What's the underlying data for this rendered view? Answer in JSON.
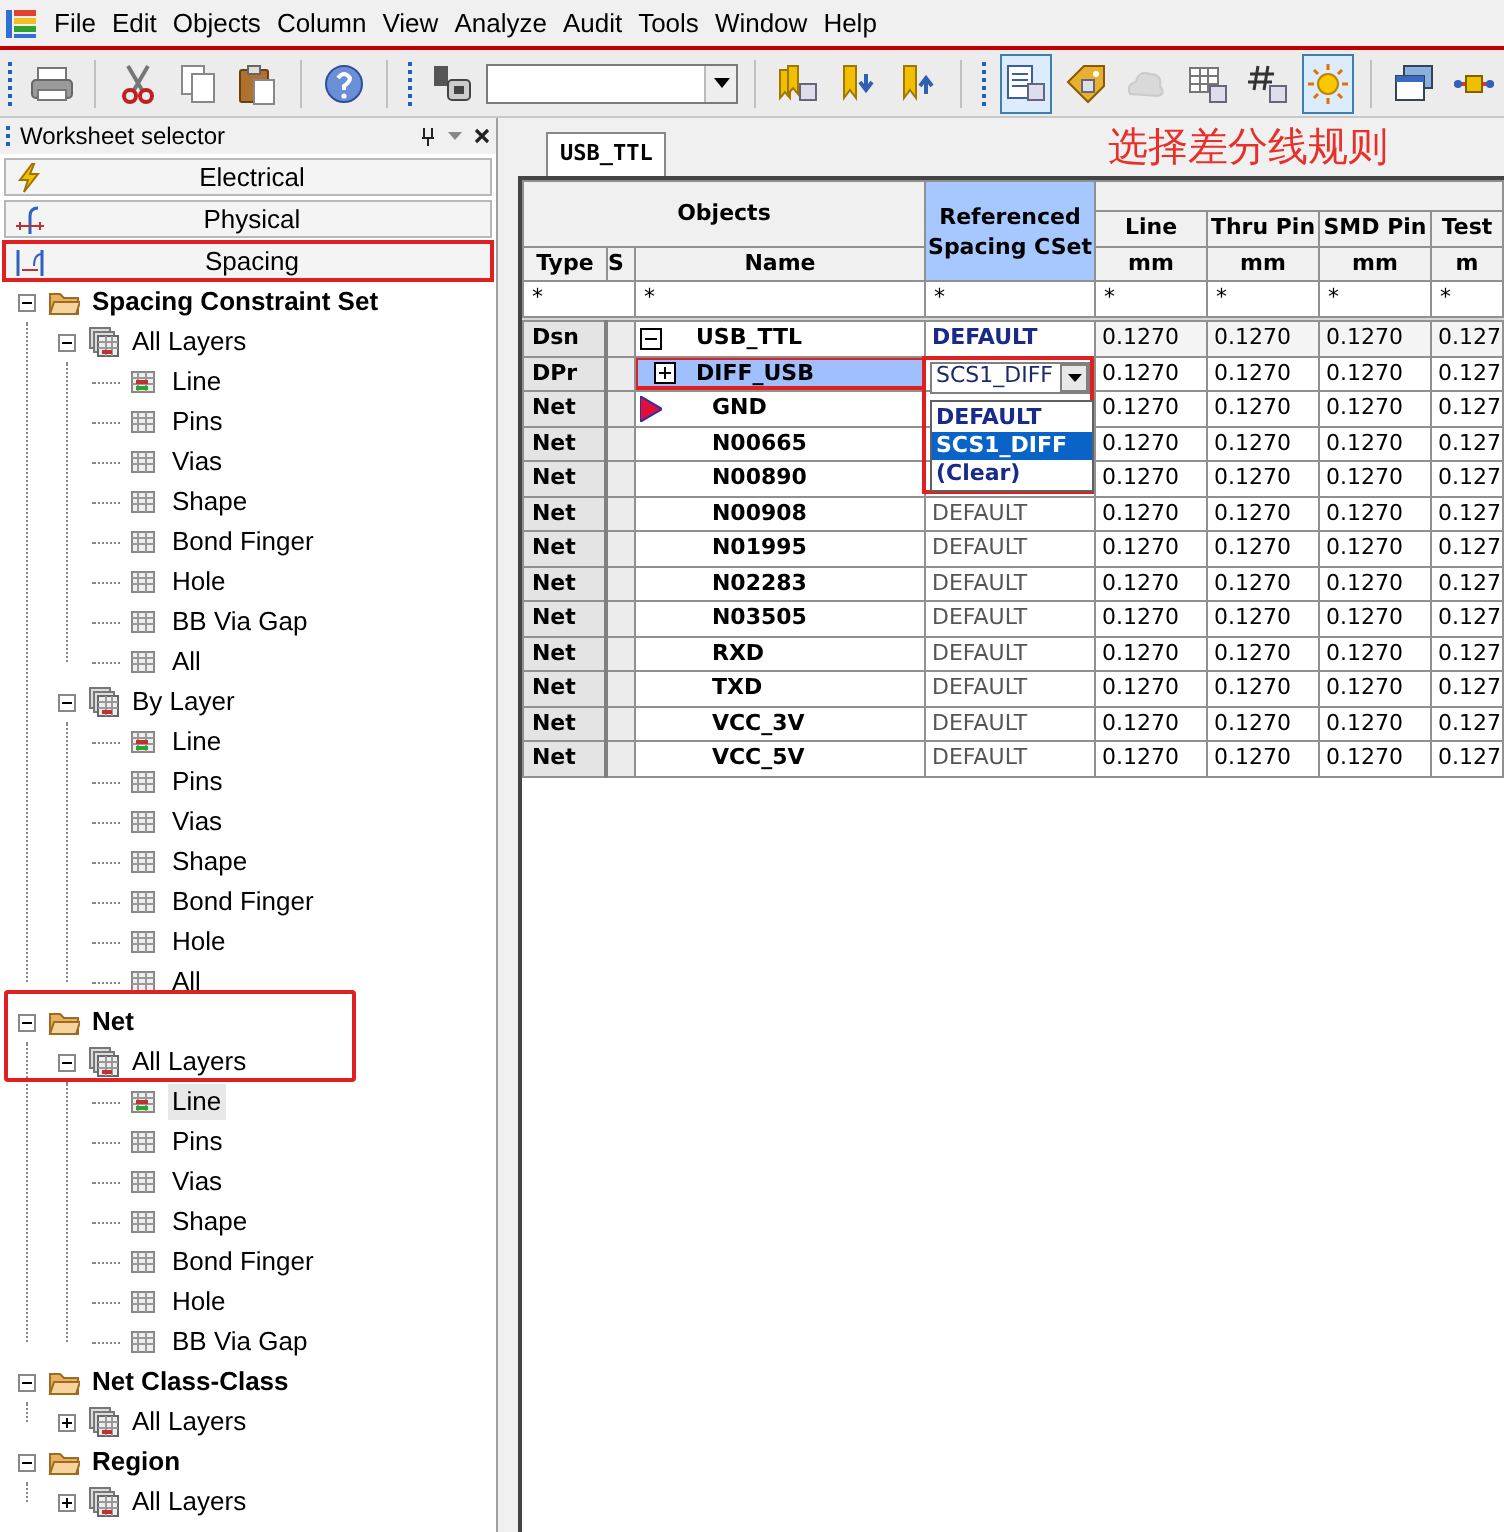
{
  "menu": [
    "File",
    "Edit",
    "Objects",
    "Column",
    "View",
    "Analyze",
    "Audit",
    "Tools",
    "Window",
    "Help"
  ],
  "toolbar": [
    {
      "kind": "grip"
    },
    {
      "kind": "printer",
      "selected": false
    },
    {
      "kind": "sep"
    },
    {
      "kind": "scissors",
      "selected": false
    },
    {
      "kind": "copy",
      "selected": false
    },
    {
      "kind": "paste",
      "selected": false
    },
    {
      "kind": "sep"
    },
    {
      "kind": "help",
      "selected": false
    },
    {
      "kind": "sep"
    },
    {
      "kind": "grip"
    },
    {
      "kind": "component",
      "selected": false
    },
    {
      "kind": "combo"
    },
    {
      "kind": "sep"
    },
    {
      "kind": "bookmarks",
      "selected": false
    },
    {
      "kind": "bookmark-down",
      "selected": false
    },
    {
      "kind": "bookmark-up",
      "selected": false
    },
    {
      "kind": "sep"
    },
    {
      "kind": "grip"
    },
    {
      "kind": "worksheet",
      "selected": true
    },
    {
      "kind": "tag",
      "selected": false
    },
    {
      "kind": "cloud",
      "selected": false,
      "disabled": true
    },
    {
      "kind": "grid",
      "selected": false
    },
    {
      "kind": "hash",
      "selected": false
    },
    {
      "kind": "sun",
      "selected": true
    },
    {
      "kind": "sep"
    },
    {
      "kind": "windows",
      "selected": false
    },
    {
      "kind": "connector",
      "selected": false
    }
  ],
  "sidebar": {
    "title": "Worksheet selector",
    "tabs": [
      {
        "label": "Electrical",
        "kind": "electrical",
        "highlighted": false
      },
      {
        "label": "Physical",
        "kind": "physical",
        "highlighted": false
      },
      {
        "label": "Spacing",
        "kind": "spacing",
        "highlighted": true
      }
    ],
    "tree": [
      {
        "label": "Spacing Constraint Set",
        "kind": "folder",
        "expanded": true,
        "selected": false,
        "highlighted": false,
        "children": [
          {
            "label": "All Layers",
            "kind": "layers",
            "expanded": true,
            "selected": false,
            "children": [
              {
                "label": "Line",
                "kind": "sheet-marked",
                "selected": false
              },
              {
                "label": "Pins",
                "kind": "sheet",
                "selected": false
              },
              {
                "label": "Vias",
                "kind": "sheet",
                "selected": false
              },
              {
                "label": "Shape",
                "kind": "sheet",
                "selected": false
              },
              {
                "label": "Bond Finger",
                "kind": "sheet",
                "selected": false
              },
              {
                "label": "Hole",
                "kind": "sheet",
                "selected": false
              },
              {
                "label": "BB Via Gap",
                "kind": "sheet",
                "selected": false
              },
              {
                "label": "All",
                "kind": "sheet",
                "selected": false
              }
            ]
          },
          {
            "label": "By Layer",
            "kind": "layers",
            "expanded": true,
            "selected": false,
            "children": [
              {
                "label": "Line",
                "kind": "sheet-marked",
                "selected": false
              },
              {
                "label": "Pins",
                "kind": "sheet",
                "selected": false
              },
              {
                "label": "Vias",
                "kind": "sheet",
                "selected": false
              },
              {
                "label": "Shape",
                "kind": "sheet",
                "selected": false
              },
              {
                "label": "Bond Finger",
                "kind": "sheet",
                "selected": false
              },
              {
                "label": "Hole",
                "kind": "sheet",
                "selected": false
              },
              {
                "label": "All",
                "kind": "sheet",
                "selected": false
              }
            ]
          }
        ]
      },
      {
        "label": "Net",
        "kind": "folder",
        "expanded": true,
        "selected": false,
        "highlighted": true,
        "children": [
          {
            "label": "All Layers",
            "kind": "layers",
            "expanded": true,
            "selected": false,
            "children": [
              {
                "label": "Line",
                "kind": "sheet-marked",
                "selected": true
              },
              {
                "label": "Pins",
                "kind": "sheet",
                "selected": false
              },
              {
                "label": "Vias",
                "kind": "sheet",
                "selected": false
              },
              {
                "label": "Shape",
                "kind": "sheet",
                "selected": false
              },
              {
                "label": "Bond Finger",
                "kind": "sheet",
                "selected": false
              },
              {
                "label": "Hole",
                "kind": "sheet",
                "selected": false
              },
              {
                "label": "BB Via Gap",
                "kind": "sheet",
                "selected": false
              }
            ]
          }
        ]
      },
      {
        "label": "Net Class-Class",
        "kind": "folder",
        "expanded": true,
        "selected": false,
        "highlighted": false,
        "children": [
          {
            "label": "All Layers",
            "kind": "layers",
            "expanded": false,
            "selected": false
          }
        ]
      },
      {
        "label": "Region",
        "kind": "folder",
        "expanded": true,
        "selected": false,
        "highlighted": false,
        "children": [
          {
            "label": "All Layers",
            "kind": "layers",
            "expanded": false,
            "selected": false
          }
        ]
      }
    ]
  },
  "workspace": {
    "tab": "USB_TTL",
    "annotation": "选择差分线规则",
    "grid": {
      "group_header": "Objects",
      "cset_header": "Referenced Spacing CSet",
      "type_header": "Type",
      "s_header": "S",
      "name_header": "Name",
      "columns": [
        {
          "label": "Line",
          "unit": "mm"
        },
        {
          "label": "Thru Pin",
          "unit": "mm"
        },
        {
          "label": "SMD Pin",
          "unit": "mm"
        },
        {
          "label": "Test",
          "unit": "m"
        }
      ],
      "filters": [
        "*",
        "*",
        "*",
        "*",
        "*",
        "*",
        "*"
      ],
      "rows": [
        {
          "kind": "design",
          "type": "Dsn",
          "name": "USB_TTL",
          "expanded": true,
          "selected": false,
          "cset": "DEFAULT",
          "values": [
            "0.1270",
            "0.1270",
            "0.1270",
            "0.127"
          ]
        },
        {
          "kind": "pair",
          "type": "DPr",
          "name": "DIFF_USB",
          "expanded": false,
          "selected": true,
          "highlighted": true,
          "values": [
            "0.1270",
            "0.1270",
            "0.1270",
            "0.127"
          ],
          "dropdown": {
            "value": "SCS1_DIFF",
            "highlighted": true,
            "options": [
              {
                "label": "DEFAULT",
                "selected": false
              },
              {
                "label": "SCS1_DIFF",
                "selected": true
              },
              {
                "label": "(Clear)",
                "selected": false
              }
            ]
          }
        },
        {
          "kind": "net",
          "type": "Net",
          "name": "GND",
          "selected": false,
          "marker": true,
          "values": [
            "0.1270",
            "0.1270",
            "0.1270",
            "0.127"
          ]
        },
        {
          "kind": "net",
          "type": "Net",
          "name": "N00665",
          "selected": false,
          "values": [
            "0.1270",
            "0.1270",
            "0.1270",
            "0.127"
          ]
        },
        {
          "kind": "net",
          "type": "Net",
          "name": "N00890",
          "selected": false,
          "values": [
            "0.1270",
            "0.1270",
            "0.1270",
            "0.127"
          ]
        },
        {
          "kind": "net",
          "type": "Net",
          "name": "N00908",
          "selected": false,
          "cset": "DEFAULT",
          "values": [
            "0.1270",
            "0.1270",
            "0.1270",
            "0.127"
          ]
        },
        {
          "kind": "net",
          "type": "Net",
          "name": "N01995",
          "selected": false,
          "cset": "DEFAULT",
          "values": [
            "0.1270",
            "0.1270",
            "0.1270",
            "0.127"
          ]
        },
        {
          "kind": "net",
          "type": "Net",
          "name": "N02283",
          "selected": false,
          "cset": "DEFAULT",
          "values": [
            "0.1270",
            "0.1270",
            "0.1270",
            "0.127"
          ]
        },
        {
          "kind": "net",
          "type": "Net",
          "name": "N03505",
          "selected": false,
          "cset": "DEFAULT",
          "values": [
            "0.1270",
            "0.1270",
            "0.1270",
            "0.127"
          ]
        },
        {
          "kind": "net",
          "type": "Net",
          "name": "RXD",
          "selected": false,
          "cset": "DEFAULT",
          "values": [
            "0.1270",
            "0.1270",
            "0.1270",
            "0.127"
          ]
        },
        {
          "kind": "net",
          "type": "Net",
          "name": "TXD",
          "selected": false,
          "cset": "DEFAULT",
          "values": [
            "0.1270",
            "0.1270",
            "0.1270",
            "0.127"
          ]
        },
        {
          "kind": "net",
          "type": "Net",
          "name": "VCC_3V",
          "selected": false,
          "cset": "DEFAULT",
          "values": [
            "0.1270",
            "0.1270",
            "0.1270",
            "0.127"
          ]
        },
        {
          "kind": "net",
          "type": "Net",
          "name": "VCC_5V",
          "selected": false,
          "cset": "DEFAULT",
          "values": [
            "0.1270",
            "0.1270",
            "0.1270",
            "0.127"
          ]
        }
      ]
    }
  }
}
